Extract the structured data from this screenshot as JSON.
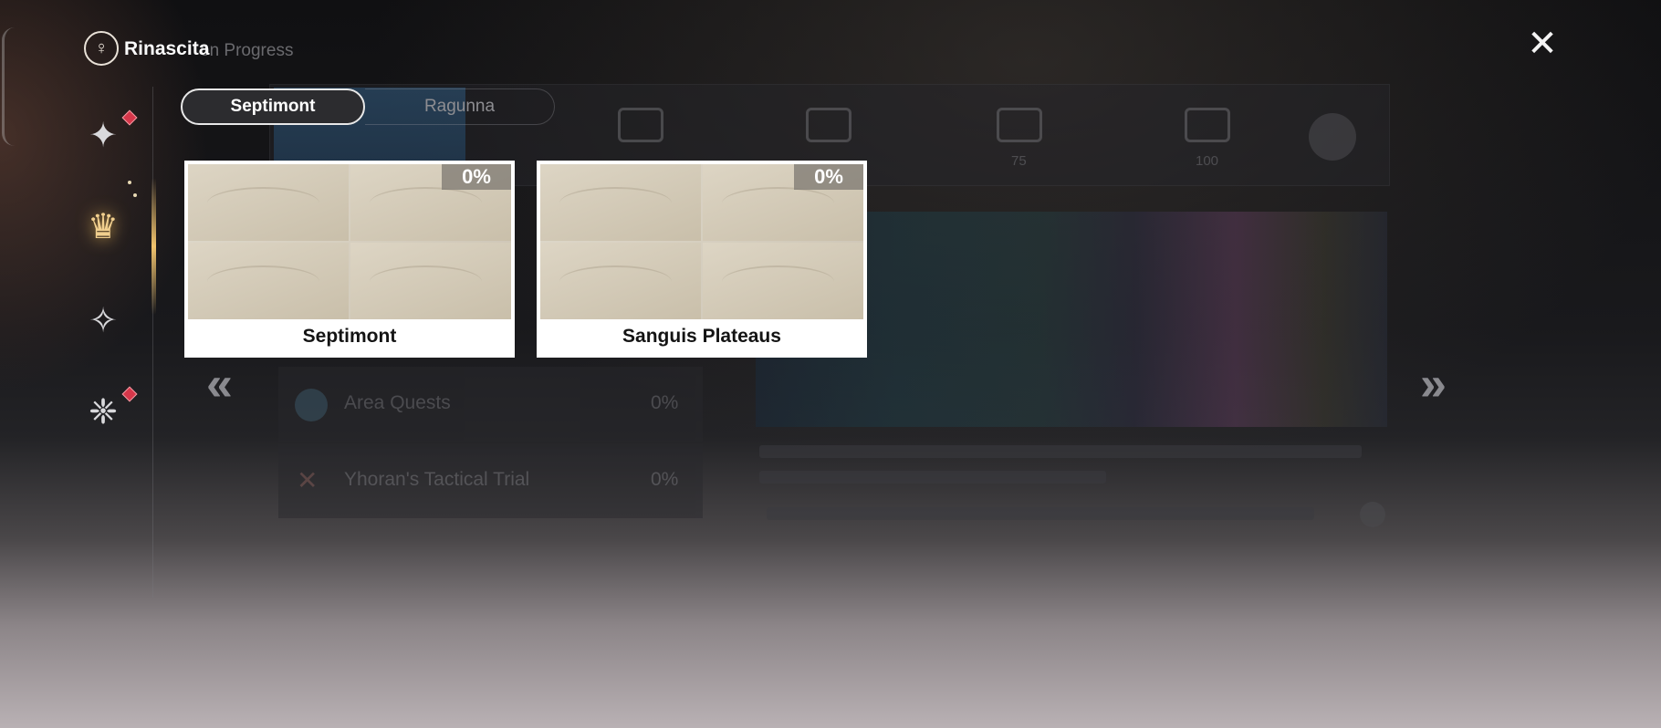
{
  "app": {
    "title": "Rinascita",
    "subtitle_fragment": "on Progress",
    "logo_glyph": "♀",
    "close_glyph": "✕"
  },
  "sidebar": {
    "items": [
      {
        "id": "explorer",
        "icon": "explorer-emblem-icon",
        "glyph": "✦",
        "badge": true,
        "active": false
      },
      {
        "id": "exploration",
        "icon": "goddess-emblem-icon",
        "glyph": "♛",
        "badge": false,
        "active": true
      },
      {
        "id": "tactical",
        "icon": "shard-emblem-icon",
        "glyph": "✧",
        "badge": false,
        "active": false
      },
      {
        "id": "beast",
        "icon": "beast-emblem-icon",
        "glyph": "❈",
        "badge": true,
        "active": false
      }
    ]
  },
  "tabs": [
    {
      "label": "Septimont",
      "active": true
    },
    {
      "label": "Ragunna",
      "active": false
    }
  ],
  "regions": [
    {
      "name": "Septimont",
      "progress_label": "0%",
      "progress": 0
    },
    {
      "name": "Sanguis Plateaus",
      "progress_label": "0%",
      "progress": 0
    }
  ],
  "nav": {
    "prev_glyph": "«",
    "next_glyph": "»"
  },
  "background_ghost": {
    "rows": [
      {
        "label": "Area Quests",
        "value": "0%"
      },
      {
        "label": "Yhoran's Tactical Trial",
        "value": "0%"
      }
    ],
    "milestones": [
      "75",
      "100"
    ]
  },
  "colors": {
    "accent_gold": "#f1cf8e",
    "badge_red": "#d6374a",
    "card_bg": "#ffffff",
    "tab_active_border": "#e8e8e8"
  }
}
